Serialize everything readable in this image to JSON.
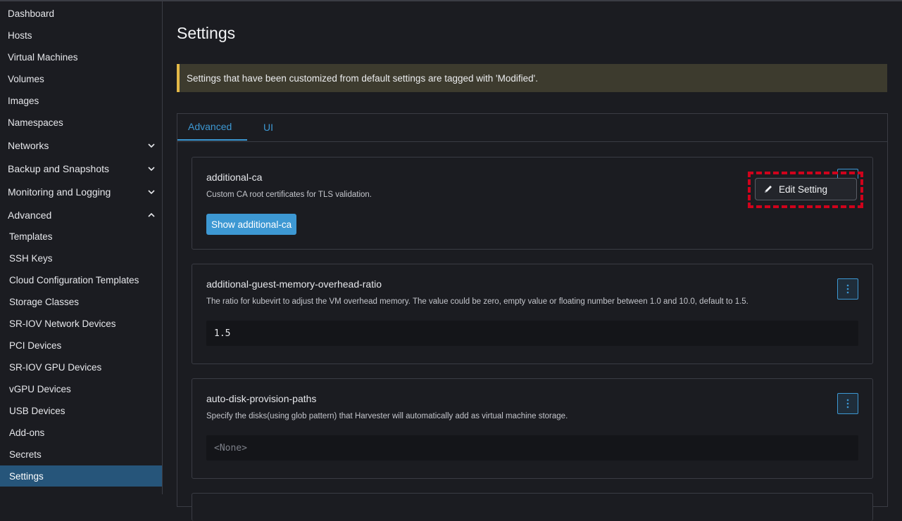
{
  "sidebar": {
    "items": [
      {
        "label": "Dashboard"
      },
      {
        "label": "Hosts"
      },
      {
        "label": "Virtual Machines"
      },
      {
        "label": "Volumes"
      },
      {
        "label": "Images"
      },
      {
        "label": "Namespaces"
      },
      {
        "label": "Networks",
        "expandable": true,
        "expanded": false
      },
      {
        "label": "Backup and Snapshots",
        "expandable": true,
        "expanded": false
      },
      {
        "label": "Monitoring and Logging",
        "expandable": true,
        "expanded": false
      },
      {
        "label": "Advanced",
        "expandable": true,
        "expanded": true
      }
    ],
    "advanced_children": [
      {
        "label": "Templates"
      },
      {
        "label": "SSH Keys"
      },
      {
        "label": "Cloud Configuration Templates"
      },
      {
        "label": "Storage Classes"
      },
      {
        "label": "SR-IOV Network Devices"
      },
      {
        "label": "PCI Devices"
      },
      {
        "label": "SR-IOV GPU Devices"
      },
      {
        "label": "vGPU Devices"
      },
      {
        "label": "USB Devices"
      },
      {
        "label": "Add-ons"
      },
      {
        "label": "Secrets"
      },
      {
        "label": "Settings",
        "active": true
      }
    ]
  },
  "main": {
    "title": "Settings",
    "banner": "Settings that have been customized from default settings are tagged with 'Modified'.",
    "tabs": [
      {
        "label": "Advanced",
        "active": true
      },
      {
        "label": "UI",
        "active": false
      }
    ],
    "settings": [
      {
        "name": "additional-ca",
        "description": "Custom CA root certificates for TLS validation.",
        "button_label": "Show additional-ca"
      },
      {
        "name": "additional-guest-memory-overhead-ratio",
        "description": "The ratio for kubevirt to adjust the VM overhead memory. The value could be zero, empty value or floating number between 1.0 and 10.0, default to 1.5.",
        "value": "1.5"
      },
      {
        "name": "auto-disk-provision-paths",
        "description": "Specify the disks(using glob pattern) that Harvester will automatically add as virtual machine storage.",
        "value": "<None>"
      }
    ],
    "dropdown": {
      "edit_label": "Edit Setting",
      "icon": "pencil-icon"
    }
  },
  "colors": {
    "accent": "#3d98d3",
    "active_nav": "#26557a",
    "banner_border": "#e3b847",
    "highlight": "#d0021b"
  }
}
